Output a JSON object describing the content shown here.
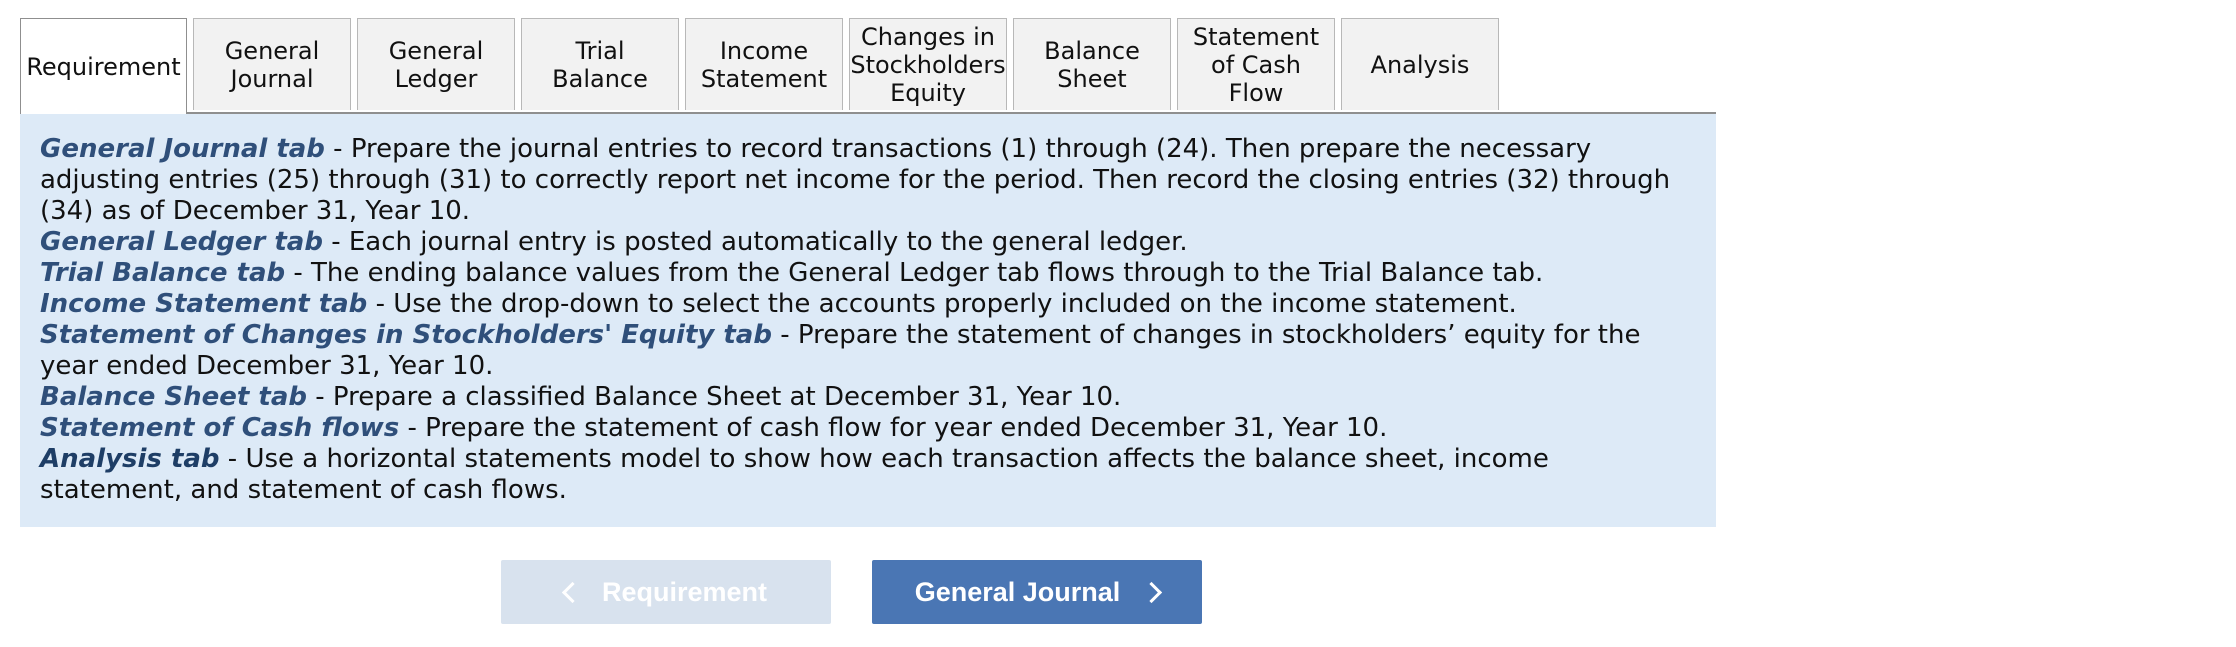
{
  "tabs": [
    {
      "label": "Requirement"
    },
    {
      "label": "General\nJournal"
    },
    {
      "label": "General\nLedger"
    },
    {
      "label": "Trial Balance"
    },
    {
      "label": "Income\nStatement"
    },
    {
      "label": "Changes in\nStockholders\nEquity"
    },
    {
      "label": "Balance\nSheet"
    },
    {
      "label": "Statement\nof Cash Flow"
    },
    {
      "label": "Analysis"
    }
  ],
  "active_tab": "Requirement",
  "instructions": [
    {
      "term": "General Journal tab",
      "text": " - Prepare the journal entries to record transactions (1) through (24). Then prepare the necessary adjusting entries (25) through (31) to correctly report net income for the period. Then record the closing entries (32) through (34) as of December 31, Year 10."
    },
    {
      "term": "General Ledger tab",
      "text": " - Each journal entry is posted automatically to the general ledger."
    },
    {
      "term": "Trial Balance tab",
      "text": " - The ending balance values from the General Ledger tab flows through to the Trial Balance tab."
    },
    {
      "term": "Income Statement tab",
      "text": " - Use the drop-down to select the accounts properly included on the income statement."
    },
    {
      "term": "Statement of Changes in Stockholders' Equity tab",
      "text": " - Prepare the statement of changes in stockholders’ equity for the year ended December 31, Year 10."
    },
    {
      "term": "Balance Sheet tab",
      "text": " - Prepare a classified Balance Sheet at December 31, Year 10."
    },
    {
      "term": "Statement of Cash flows",
      "text": " - Prepare the statement of cash flow for year ended December 31, Year 10."
    },
    {
      "term": "Analysis tab",
      "text": " - Use a horizontal statements model to show how each transaction affects the balance sheet, income statement, and statement of cash flows."
    }
  ],
  "nav": {
    "prev_label": "Requirement",
    "next_label": "General Journal"
  },
  "colors": {
    "content_bg": "#ddeaf7",
    "term": "#2f4f7a",
    "next_button": "#4a76b4",
    "prev_button_disabled": "#d8e2ee"
  }
}
